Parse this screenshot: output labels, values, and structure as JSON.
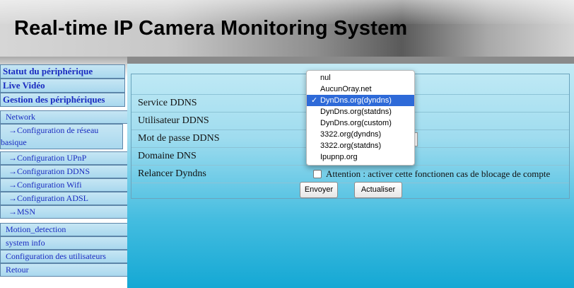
{
  "header": {
    "title": "Real-time IP Camera Monitoring System"
  },
  "sidebar": {
    "items": [
      {
        "label": "Statut du périphérique"
      },
      {
        "label": "Live Vidéo"
      },
      {
        "label": "Gestion des périphériques"
      },
      {
        "label": "Network"
      },
      {
        "label": "→Configuration de réseau basique",
        "line1": "→Configuration de réseau",
        "line2": "basique"
      },
      {
        "label": "→Configuration UPnP"
      },
      {
        "label": "→Configuration DDNS"
      },
      {
        "label": "→Configuration Wifi"
      },
      {
        "label": "→Configuration ADSL"
      },
      {
        "label": "→MSN"
      },
      {
        "label": "Motion_detection"
      },
      {
        "label": "system info"
      },
      {
        "label": "Configuration des utilisateurs"
      },
      {
        "label": "Retour"
      }
    ]
  },
  "form": {
    "rows": [
      {
        "label": "Service DDNS"
      },
      {
        "label": "Utilisateur DDNS"
      },
      {
        "label": "Mot de passe DDNS"
      },
      {
        "label": "Domaine DNS"
      },
      {
        "label": "Relancer Dyndns"
      }
    ],
    "restart_checkbox_label": "Attention : activer cette fonctionen cas de blocage de compte",
    "restart_checked": false
  },
  "buttons": {
    "submit": "Envoyer",
    "refresh": "Actualiser"
  },
  "dropdown": {
    "checkmark": "✓",
    "selected_index": 2,
    "options": [
      "nul",
      "AucunOray.net",
      "DynDns.org(dyndns)",
      "DynDns.org(statdns)",
      "DynDns.org(custom)",
      "3322.org(dyndns)",
      "3322.org(statdns)",
      "Ipupnp.org"
    ]
  }
}
